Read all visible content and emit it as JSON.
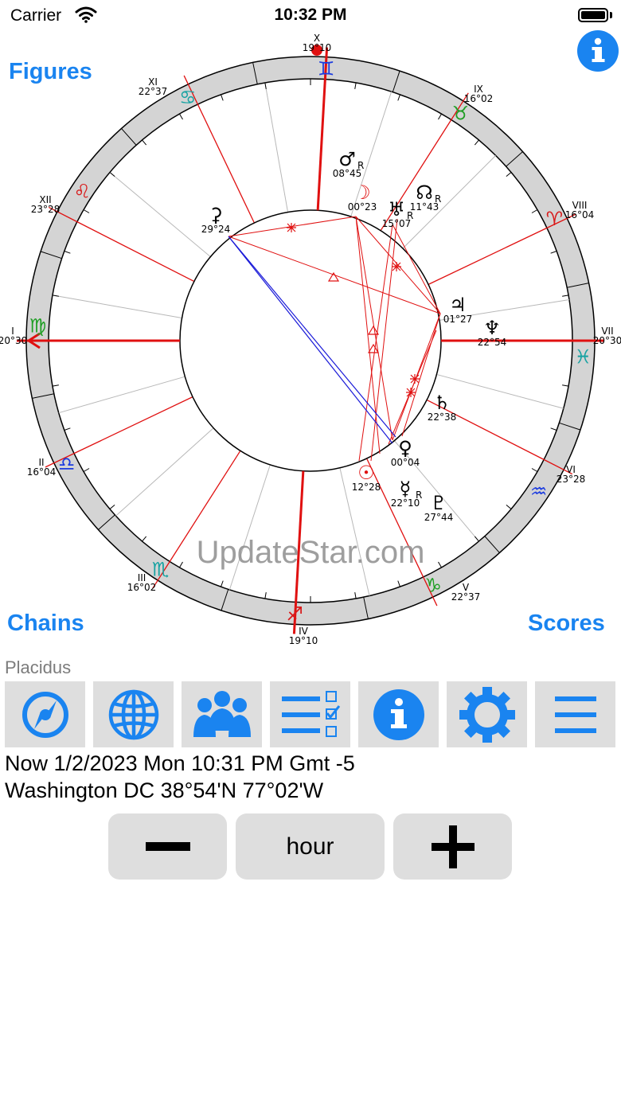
{
  "status_bar": {
    "carrier": "Carrier",
    "time": "10:32 PM"
  },
  "top_links": {
    "figures": "Figures",
    "chains": "Chains",
    "scores": "Scores"
  },
  "watermark": "UpdateStar.com",
  "house_system": "Placidus",
  "chart": {
    "houses": [
      {
        "label": "I",
        "degree": "20°30"
      },
      {
        "label": "II",
        "degree": "16°04"
      },
      {
        "label": "III",
        "degree": "16°02"
      },
      {
        "label": "IV",
        "degree": "19°10"
      },
      {
        "label": "V",
        "degree": "22°37"
      },
      {
        "label": "VI",
        "degree": "23°28"
      },
      {
        "label": "VII",
        "degree": "20°30"
      },
      {
        "label": "VIII",
        "degree": "16°04"
      },
      {
        "label": "IX",
        "degree": "16°02"
      },
      {
        "label": "X",
        "degree": "19°10"
      },
      {
        "label": "XI",
        "degree": "22°37"
      },
      {
        "label": "XII",
        "degree": "23°28"
      }
    ],
    "planets": [
      {
        "name": "Mars",
        "symbol": "♂",
        "degree": "08°45",
        "retro": "R"
      },
      {
        "name": "Moon",
        "symbol": "☽",
        "degree": "00°23",
        "retro": ""
      },
      {
        "name": "Uranus",
        "symbol": "♅",
        "degree": "15°07",
        "retro": "R"
      },
      {
        "name": "Node",
        "symbol": "☊",
        "degree": "11°43",
        "retro": "R"
      },
      {
        "name": "Ceres",
        "symbol": "⚳",
        "degree": "29°24",
        "retro": ""
      },
      {
        "name": "Jupiter",
        "symbol": "♃",
        "degree": "01°27",
        "retro": ""
      },
      {
        "name": "Neptune",
        "symbol": "♆",
        "degree": "22°54",
        "retro": ""
      },
      {
        "name": "Saturn",
        "symbol": "♄",
        "degree": "22°38",
        "retro": ""
      },
      {
        "name": "Venus",
        "symbol": "♀",
        "degree": "00°04",
        "retro": ""
      },
      {
        "name": "Sun",
        "symbol": "☉",
        "degree": "12°28",
        "retro": ""
      },
      {
        "name": "Mercury",
        "symbol": "☿",
        "degree": "22°10",
        "retro": "R"
      },
      {
        "name": "Pluto",
        "symbol": "♇",
        "degree": "27°44",
        "retro": ""
      }
    ],
    "signs": [
      {
        "name": "Gemini",
        "symbol": "♊",
        "color": "#1c3ce0"
      },
      {
        "name": "Taurus",
        "symbol": "♉",
        "color": "#1f9e24"
      },
      {
        "name": "Aries",
        "symbol": "♈",
        "color": "#d81b1b"
      },
      {
        "name": "Pisces",
        "symbol": "♓",
        "color": "#17a2a2"
      },
      {
        "name": "Aquarius",
        "symbol": "♒",
        "color": "#1c3ce0"
      },
      {
        "name": "Capricorn",
        "symbol": "♑",
        "color": "#1f9e24"
      },
      {
        "name": "Sagittarius",
        "symbol": "♐",
        "color": "#d81b1b"
      },
      {
        "name": "Scorpio",
        "symbol": "♏",
        "color": "#17a2a2"
      },
      {
        "name": "Libra",
        "symbol": "♎",
        "color": "#1c3ce0"
      },
      {
        "name": "Virgo",
        "symbol": "♍",
        "color": "#1f9e24"
      },
      {
        "name": "Leo",
        "symbol": "♌",
        "color": "#d81b1b"
      },
      {
        "name": "Cancer",
        "symbol": "♋",
        "color": "#17a2a2"
      }
    ]
  },
  "toolbar": [
    {
      "name": "compass",
      "icon": "compass-icon"
    },
    {
      "name": "globe",
      "icon": "globe-icon"
    },
    {
      "name": "people",
      "icon": "people-icon"
    },
    {
      "name": "checklist",
      "icon": "checklist-icon"
    },
    {
      "name": "info",
      "icon": "info-icon"
    },
    {
      "name": "settings",
      "icon": "gear-icon"
    },
    {
      "name": "menu",
      "icon": "menu-icon"
    }
  ],
  "datetime_line": "Now 1/2/2023 Mon 10:31 PM Gmt -5",
  "location_line": "Washington DC 38°54'N 77°02'W",
  "stepper": {
    "unit": "hour"
  },
  "colors": {
    "accent": "#1a84f0",
    "house_line": "#e01010",
    "aspect_blue": "#1a1ad8"
  }
}
